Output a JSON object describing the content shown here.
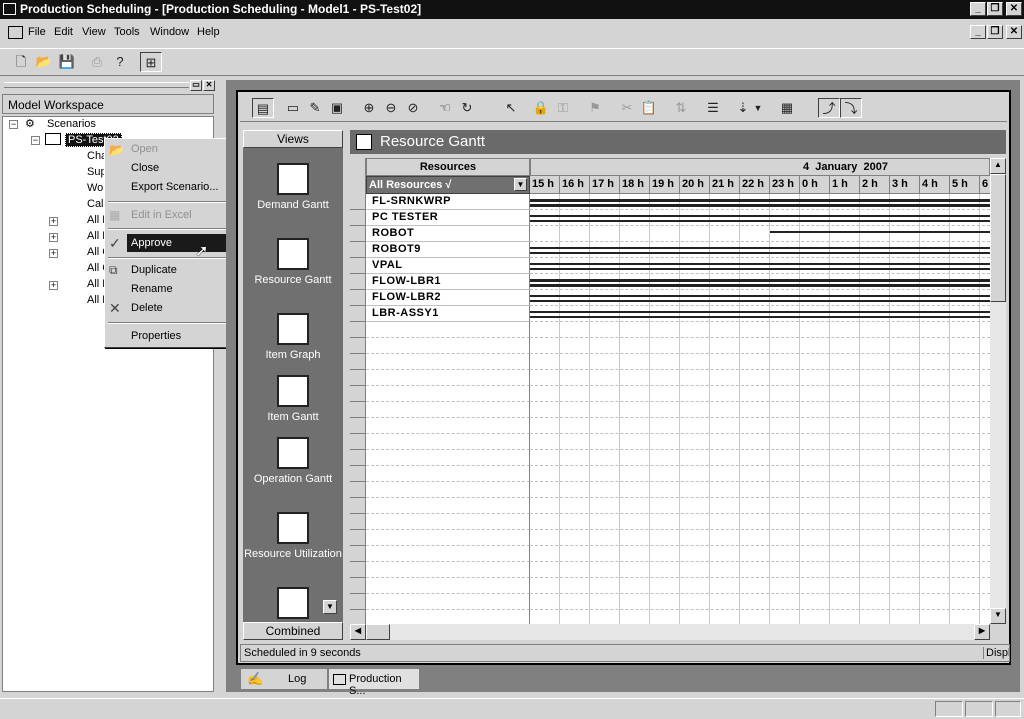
{
  "titlebar": {
    "title": "Production Scheduling - [Production Scheduling - Model1 - PS-Test02]"
  },
  "menu": [
    "File",
    "Edit",
    "View",
    "Tools",
    "Window",
    "Help"
  ],
  "workspace": {
    "header": "Model Workspace",
    "root": "Scenarios",
    "scenario": "PS-Test02",
    "children": [
      "Cha",
      "Sup",
      "Wo",
      "Cal",
      "All F",
      "All F",
      "All C",
      "All C",
      "All F",
      "All E"
    ]
  },
  "context_menu": {
    "items": [
      {
        "label": "Open",
        "disabled": true
      },
      {
        "label": "Close",
        "disabled": false
      },
      {
        "label": "Export Scenario...",
        "disabled": false
      },
      {
        "label": "Edit in Excel",
        "disabled": true
      },
      {
        "label": "Approve",
        "disabled": false,
        "highlighted": true
      },
      {
        "label": "Duplicate",
        "disabled": false
      },
      {
        "label": "Rename",
        "disabled": false
      },
      {
        "label": "Delete",
        "disabled": false
      },
      {
        "label": "Properties",
        "disabled": false
      }
    ]
  },
  "views": {
    "header": "Views",
    "items": [
      "Demand Gantt",
      "Resource Gantt",
      "Item Graph",
      "Item Gantt",
      "Operation Gantt",
      "Resource Utilization"
    ],
    "footer": "Combined"
  },
  "gantt": {
    "title": "Resource Gantt",
    "col_header": "Resources",
    "filter": "All Resources",
    "date": "4  January  2007",
    "hours": [
      "15 h",
      "16 h",
      "17 h",
      "18 h",
      "19 h",
      "20 h",
      "21 h",
      "22 h",
      "23 h",
      "0 h",
      "1 h",
      "2 h",
      "3 h",
      "4 h",
      "5 h",
      "6"
    ],
    "resources": [
      "FL-SRNKWRP",
      "PC TESTER",
      "ROBOT",
      "ROBOT9",
      "VPAL",
      "FLOW-LBR1",
      "FLOW-LBR2",
      "LBR-ASSY1"
    ]
  },
  "status": {
    "text": "Scheduled in 9 seconds",
    "right": "Displ"
  },
  "tabs": [
    "Log",
    "Production S..."
  ]
}
